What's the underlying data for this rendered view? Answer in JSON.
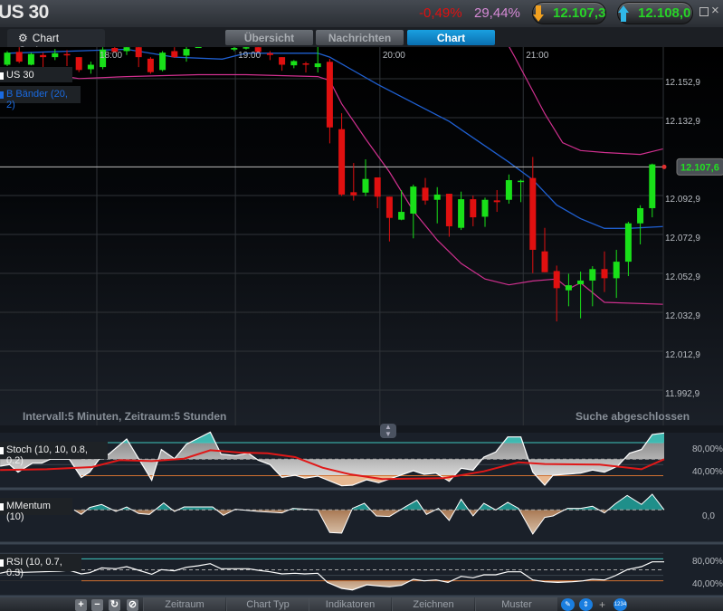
{
  "header": {
    "title": "US 30",
    "change": "-0,49%",
    "percent": "29,44%",
    "sell_price": "12.107,3",
    "buy_price": "12.108,0"
  },
  "tabs": {
    "chart_options": "Chart Optionen",
    "items": [
      {
        "label": "Übersicht",
        "active": false
      },
      {
        "label": "Nachrichten",
        "active": false
      },
      {
        "label": "Chart",
        "active": true
      }
    ]
  },
  "legend": {
    "instrument": "US 30",
    "bollinger": "B Bänder (20, 2)"
  },
  "footer": {
    "interval": "Intervall:5 Minuten, Zeitraum:5 Stunden",
    "status": "Suche abgeschlossen"
  },
  "indicators": {
    "stoch_label": "Stoch (10, 10, 0.8, 0.2)",
    "momentum_label": "MMentum (10)",
    "rsi_label": "RSI (10, 0.7, 0.3)",
    "stoch_axis": [
      "80,00%",
      "40,00%"
    ],
    "momentum_axis": [
      "0,0"
    ],
    "rsi_axis": [
      "80,00%",
      "40,00%"
    ]
  },
  "toolbar": {
    "zoom_in": "+",
    "zoom_out": "−",
    "items": [
      "Zeitraum",
      "Chart Typ",
      "Indikatoren",
      "Zeichnen",
      "Muster"
    ],
    "numbers_icon": "1234"
  },
  "colors": {
    "up": "#19e019",
    "down": "#e01010",
    "mid_band": "#1f5fd0",
    "outer_band": "#d0308f",
    "accent": "#1aa0e0"
  },
  "chart_data": {
    "type": "candlestick",
    "instrument": "US 30",
    "interval_minutes": 5,
    "time_labels": [
      {
        "label": "18:00",
        "index": 7.5
      },
      {
        "label": "19:00",
        "index": 19.1
      },
      {
        "label": "20:00",
        "index": 31.2
      },
      {
        "label": "21:00",
        "index": 43.2
      }
    ],
    "y_ticks": [
      "12.152,9",
      "12.132,9",
      "12.092,9",
      "12.072,9",
      "12.052,9",
      "12.032,9",
      "12.012,9",
      "11.992,9"
    ],
    "y_tick_values": [
      12152.9,
      12132.9,
      12092.9,
      12072.9,
      12052.9,
      12032.9,
      12012.9,
      11992.9
    ],
    "current_price": 12107.6,
    "current_price_label": "12.107,6",
    "candles": [
      [
        12160.1,
        12167.1,
        12159.4,
        12166.3
      ],
      [
        12166.7,
        12169.1,
        12160.9,
        12161.7
      ],
      [
        12160.1,
        12166.3,
        12159.8,
        12165.6
      ],
      [
        12165.1,
        12166.3,
        12158.9,
        12164.0
      ],
      [
        12164.0,
        12168.2,
        12162.5,
        12166.0
      ],
      [
        12165.6,
        12167.6,
        12159.4,
        12165.1
      ],
      [
        12164.0,
        12164.0,
        12156.3,
        12157.4
      ],
      [
        12157.8,
        12161.7,
        12155.5,
        12160.1
      ],
      [
        12158.9,
        12169.1,
        12157.8,
        12167.9
      ],
      [
        12168.7,
        12169.8,
        12166.3,
        12166.7
      ],
      [
        12167.1,
        12170.2,
        12165.1,
        12169.1
      ],
      [
        12169.1,
        12170.2,
        12158.9,
        12164.0
      ],
      [
        12163.2,
        12164.0,
        12155.5,
        12156.3
      ],
      [
        12157.4,
        12167.1,
        12156.7,
        12166.3
      ],
      [
        12167.1,
        12169.1,
        12163.6,
        12164.0
      ],
      [
        12164.8,
        12169.4,
        12161.7,
        12168.2
      ],
      [
        12169.1,
        12169.4,
        12168.7,
        12169.4
      ],
      [
        12172.0,
        12175.0,
        12171.0,
        12173.0
      ],
      [
        12174.0,
        12176.0,
        12170.0,
        12172.0
      ],
      [
        12167.9,
        12169.4,
        12167.1,
        12168.7
      ],
      [
        12168.7,
        12170.2,
        12167.9,
        12169.1
      ],
      [
        12169.1,
        12169.4,
        12166.3,
        12166.7
      ],
      [
        12166.0,
        12167.1,
        12162.5,
        12165.1
      ],
      [
        12164.0,
        12164.0,
        12157.0,
        12160.1
      ],
      [
        12159.8,
        12162.5,
        12158.3,
        12162.0
      ],
      [
        12160.8,
        12161.6,
        12156.1,
        12160.3
      ],
      [
        12158.9,
        12169.3,
        12156.1,
        12160.8
      ],
      [
        12161.6,
        12163.1,
        12119.7,
        12127.9
      ],
      [
        12127.0,
        12135.2,
        12092.6,
        12093.4
      ],
      [
        12094.6,
        12109.6,
        12090.3,
        12093.0
      ],
      [
        12094.4,
        12111.5,
        12092.6,
        12101.4
      ],
      [
        12102.2,
        12102.2,
        12086.4,
        12092.3
      ],
      [
        12092.3,
        12092.3,
        12069.3,
        12081.4
      ],
      [
        12080.5,
        12095.7,
        12080.2,
        12084.5
      ],
      [
        12083.6,
        12098.5,
        12070.9,
        12097.5
      ],
      [
        12096.9,
        12101.9,
        12088.2,
        12090.3
      ],
      [
        12090.7,
        12097.2,
        12078.6,
        12093.4
      ],
      [
        12093.8,
        12093.8,
        12071.7,
        12077.1
      ],
      [
        12076.3,
        12094.9,
        12075.2,
        12091.0
      ],
      [
        12091.0,
        12092.9,
        12077.1,
        12081.7
      ],
      [
        12082.0,
        12091.8,
        12076.8,
        12090.7
      ],
      [
        12090.4,
        12095.7,
        12084.5,
        12089.5
      ],
      [
        12090.7,
        12103.7,
        12088.7,
        12100.8
      ],
      [
        12100.0,
        12101.1,
        12089.5,
        12100.5
      ],
      [
        12101.9,
        12112.7,
        12053.0,
        12065.0
      ],
      [
        12064.2,
        12076.3,
        12053.5,
        12053.5
      ],
      [
        12054.1,
        12056.9,
        12028.2,
        12045.3
      ],
      [
        12044.2,
        12052.7,
        12036.0,
        12046.8
      ],
      [
        12047.3,
        12053.8,
        12029.8,
        12049.2
      ],
      [
        12049.2,
        12056.6,
        12036.0,
        12055.1
      ],
      [
        12055.1,
        12064.2,
        12043.3,
        12050.4
      ],
      [
        12050.4,
        12065.0,
        12040.3,
        12058.9
      ],
      [
        12058.9,
        12079.4,
        12051.5,
        12078.6
      ],
      [
        12078.6,
        12087.9,
        12067.8,
        12086.4
      ],
      [
        12086.4,
        12109.3,
        12081.7,
        12108.9
      ]
    ],
    "bollinger": {
      "mid": [
        [
          0,
          12166
        ],
        [
          10,
          12168
        ],
        [
          14,
          12164
        ],
        [
          18,
          12163
        ],
        [
          20,
          12166
        ],
        [
          26,
          12166
        ],
        [
          27,
          12164
        ],
        [
          31,
          12150
        ],
        [
          37,
          12131
        ],
        [
          42,
          12110
        ],
        [
          44,
          12101
        ],
        [
          46,
          12088
        ],
        [
          48,
          12081
        ],
        [
          50,
          12076
        ],
        [
          52,
          12076
        ],
        [
          55,
          12077
        ]
      ],
      "lower": [
        [
          0,
          12156
        ],
        [
          4,
          12155
        ],
        [
          6,
          12153
        ],
        [
          10,
          12154
        ],
        [
          16,
          12155
        ],
        [
          20,
          12155
        ],
        [
          26,
          12154
        ],
        [
          27,
          12152
        ],
        [
          28,
          12140
        ],
        [
          30,
          12122
        ],
        [
          32,
          12105
        ],
        [
          34,
          12085
        ],
        [
          36,
          12070
        ],
        [
          38,
          12058
        ],
        [
          40,
          12050
        ],
        [
          42,
          12047
        ],
        [
          44,
          12049
        ],
        [
          46,
          12050
        ],
        [
          47,
          12045
        ],
        [
          48,
          12048
        ],
        [
          50,
          12038
        ],
        [
          55,
          12037
        ]
      ],
      "upper": [
        [
          41.5,
          12175
        ],
        [
          42.5,
          12164
        ],
        [
          45,
          12135
        ],
        [
          46.5,
          12120
        ],
        [
          48,
          12116
        ],
        [
          50,
          12115
        ],
        [
          53,
          12114
        ],
        [
          55,
          12117
        ]
      ]
    },
    "stoch": {
      "levels": {
        "upper": 80,
        "mid": 50,
        "lower": 20
      },
      "main": [
        [
          -0.6,
          37.2
        ],
        [
          0.2,
          40
        ],
        [
          0.9,
          26.3
        ],
        [
          2.1,
          42.7
        ],
        [
          2.9,
          42.7
        ],
        [
          3.6,
          49.8
        ],
        [
          5.2,
          49.8
        ],
        [
          6.2,
          16.9
        ],
        [
          6.9,
          26.3
        ],
        [
          7.7,
          49.8
        ],
        [
          8.5,
          59.1
        ],
        [
          10,
          86.5
        ],
        [
          11,
          50.9
        ],
        [
          12.1,
          11.5
        ],
        [
          12.9,
          67.4
        ],
        [
          14,
          50.9
        ],
        [
          15,
          77.2
        ],
        [
          17,
          99.1
        ],
        [
          17.9,
          59.1
        ],
        [
          19.1,
          56.4
        ],
        [
          20.2,
          60.8
        ],
        [
          21,
          48.2
        ],
        [
          22,
          40
        ],
        [
          23,
          16.9
        ],
        [
          24.1,
          20.8
        ],
        [
          24.9,
          15.3
        ],
        [
          26,
          19.1
        ],
        [
          28,
          1.6
        ],
        [
          28.9,
          2.7
        ],
        [
          30.1,
          12.6
        ],
        [
          31.1,
          7.1
        ],
        [
          32.2,
          15.3
        ],
        [
          34,
          29
        ],
        [
          34.9,
          22.4
        ],
        [
          35.9,
          24.6
        ],
        [
          37,
          9.8
        ],
        [
          38,
          33.4
        ],
        [
          39,
          30.1
        ],
        [
          39.9,
          53.7
        ],
        [
          40.9,
          63
        ],
        [
          41.9,
          90.4
        ],
        [
          43,
          90.4
        ],
        [
          44,
          26.3
        ],
        [
          45,
          2.7
        ],
        [
          45.7,
          20.8
        ],
        [
          48,
          24.6
        ],
        [
          49,
          30.1
        ],
        [
          50,
          26.3
        ],
        [
          51.1,
          37.2
        ],
        [
          52.1,
          60.8
        ],
        [
          53.1,
          67.4
        ],
        [
          54,
          94.8
        ],
        [
          55,
          97.5
        ]
      ],
      "signal": [
        [
          -0.6,
          30.1
        ],
        [
          3.3,
          31.7
        ],
        [
          7.1,
          35.6
        ],
        [
          9.4,
          48.2
        ],
        [
          12.1,
          46.5
        ],
        [
          14.8,
          50.9
        ],
        [
          17,
          66.1
        ],
        [
          19.5,
          61.9
        ],
        [
          21.8,
          60.8
        ],
        [
          24.1,
          53.7
        ],
        [
          26.4,
          34.5
        ],
        [
          28.7,
          22.4
        ],
        [
          31.4,
          13.7
        ],
        [
          36.5,
          15.3
        ],
        [
          39.9,
          27.9
        ],
        [
          42.8,
          44.3
        ],
        [
          45,
          41.1
        ],
        [
          49.6,
          40
        ],
        [
          53.1,
          31.7
        ],
        [
          55,
          49.8
        ]
      ]
    },
    "momentum": [
      [
        5.6,
        0
      ],
      [
        6.2,
        -7.5
      ],
      [
        6.9,
        4
      ],
      [
        7.9,
        9
      ],
      [
        9.1,
        -2.5
      ],
      [
        10,
        5
      ],
      [
        11,
        -6
      ],
      [
        11.9,
        -7.5
      ],
      [
        13.1,
        11.5
      ],
      [
        14,
        -2.5
      ],
      [
        14.8,
        5
      ],
      [
        17.2,
        5
      ],
      [
        18.1,
        -9
      ],
      [
        19.1,
        1
      ],
      [
        21,
        -2.5
      ],
      [
        23,
        -5
      ],
      [
        23.9,
        2.5
      ],
      [
        26,
        0
      ],
      [
        27,
        -37.5
      ],
      [
        28,
        -38.5
      ],
      [
        28.9,
        2.5
      ],
      [
        29.9,
        11
      ],
      [
        30.9,
        -10
      ],
      [
        32,
        -11
      ],
      [
        33.4,
        6
      ],
      [
        34.3,
        16
      ],
      [
        35.1,
        -7.5
      ],
      [
        36.1,
        2.5
      ],
      [
        37,
        -17.5
      ],
      [
        38,
        17.5
      ],
      [
        39,
        -10
      ],
      [
        39.9,
        11
      ],
      [
        40.9,
        0
      ],
      [
        41.9,
        12.5
      ],
      [
        42.8,
        2.5
      ],
      [
        44,
        -40
      ],
      [
        45,
        -12.5
      ],
      [
        45.7,
        -10
      ],
      [
        46.9,
        2.5
      ],
      [
        48,
        2.5
      ],
      [
        49,
        6
      ],
      [
        50,
        -5
      ],
      [
        50.9,
        10
      ],
      [
        51.9,
        24
      ],
      [
        53.1,
        9
      ],
      [
        54,
        26
      ],
      [
        55,
        0
      ]
    ],
    "rsi": {
      "levels": {
        "upper": 70,
        "mid": 50,
        "lower": 30
      },
      "values": [
        [
          -0.6,
          43.7
        ],
        [
          0.2,
          47.5
        ],
        [
          1.3,
          45.3
        ],
        [
          2.9,
          46.4
        ],
        [
          4.4,
          47.5
        ],
        [
          5.2,
          49.2
        ],
        [
          6.2,
          42.6
        ],
        [
          6.9,
          44.8
        ],
        [
          7.9,
          53.5
        ],
        [
          9.1,
          51.9
        ],
        [
          10,
          55.7
        ],
        [
          11,
          49.2
        ],
        [
          12.1,
          42
        ],
        [
          12.9,
          50.3
        ],
        [
          14,
          48.1
        ],
        [
          15,
          54.6
        ],
        [
          16,
          57.4
        ],
        [
          17,
          61.2
        ],
        [
          17.9,
          51.9
        ],
        [
          19.5,
          51.9
        ],
        [
          20.2,
          51.9
        ],
        [
          21,
          49.2
        ],
        [
          22,
          46.4
        ],
        [
          23,
          42.6
        ],
        [
          24.1,
          43.7
        ],
        [
          24.9,
          42.6
        ],
        [
          26,
          43.7
        ],
        [
          26.8,
          27.2
        ],
        [
          28,
          16.3
        ],
        [
          28.9,
          13.5
        ],
        [
          30.1,
          22.9
        ],
        [
          31.1,
          20.7
        ],
        [
          32,
          19
        ],
        [
          33,
          21.8
        ],
        [
          34,
          32.7
        ],
        [
          34.9,
          30
        ],
        [
          35.9,
          31.6
        ],
        [
          36.9,
          27.2
        ],
        [
          38,
          38.2
        ],
        [
          39,
          35.5
        ],
        [
          39.9,
          40.9
        ],
        [
          40.9,
          40.9
        ],
        [
          41.9,
          46.4
        ],
        [
          43,
          46.4
        ],
        [
          44,
          31.6
        ],
        [
          45,
          28.3
        ],
        [
          46.1,
          27.2
        ],
        [
          47.3,
          28.3
        ],
        [
          48.2,
          30
        ],
        [
          49,
          32.7
        ],
        [
          50,
          31.6
        ],
        [
          50.9,
          39.3
        ],
        [
          51.9,
          50.3
        ],
        [
          53.1,
          55.7
        ],
        [
          54,
          64.5
        ],
        [
          55,
          64.5
        ]
      ]
    }
  }
}
